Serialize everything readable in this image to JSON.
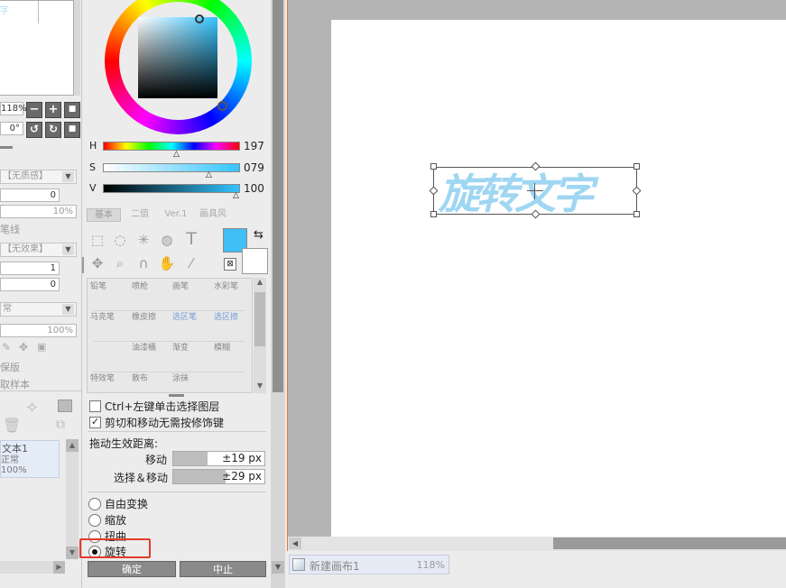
{
  "left": {
    "zoom": "118%",
    "angle": "0°",
    "zoom_buttons": [
      "−",
      "+",
      "■"
    ],
    "rot_buttons": [
      "↺",
      "↻",
      "■"
    ],
    "texture_dd": "【无质感】",
    "texture_v1": "0",
    "texture_v2": "10%",
    "stroke_label": "笔线",
    "effect_dd": "【无效果】",
    "effect_v1": "1",
    "effect_v2": "0",
    "blend_dd": "常",
    "opacity": "100%",
    "protect_label": "保版",
    "sample_label": "取样本",
    "layer_name": "文本1",
    "layer_mode": "正常",
    "layer_opacity": "100%"
  },
  "color": {
    "h_label": "H",
    "h_value": "197",
    "s_label": "S",
    "s_value": "079",
    "v_label": "V",
    "v_value": "100",
    "current": "#3fbff5",
    "hue_color": "#33c4ff"
  },
  "tool_tabs": [
    "基本",
    "二值",
    "Ver.1",
    "画具风"
  ],
  "brushes": [
    "铅笔",
    "喷枪",
    "画笔",
    "水彩笔",
    "马克笔",
    "橡皮擦",
    "选区笔",
    "选区擦",
    "",
    "油漆桶",
    "渐变",
    "模糊",
    "特效笔",
    "散布",
    "涂抹",
    ""
  ],
  "options": {
    "ctrl_click": "Ctrl+左键单击选择图层",
    "cut_move": "剪切和移动无需按修饰键",
    "drag_title": "拖动生效距离:",
    "move_label": "移动",
    "move_value": "±19 px",
    "selmove_label": "选择＆移动",
    "selmove_value": "±29 px"
  },
  "transform": [
    "自由变换",
    "缩放",
    "扭曲",
    "旋转"
  ],
  "buttons": {
    "ok": "确定",
    "cancel": "中止"
  },
  "canvas": {
    "text": "旋转文字",
    "text_color": "#8fd0f0"
  },
  "statusbar": {
    "doc_name": "新建画布1",
    "doc_zoom": "118%"
  }
}
